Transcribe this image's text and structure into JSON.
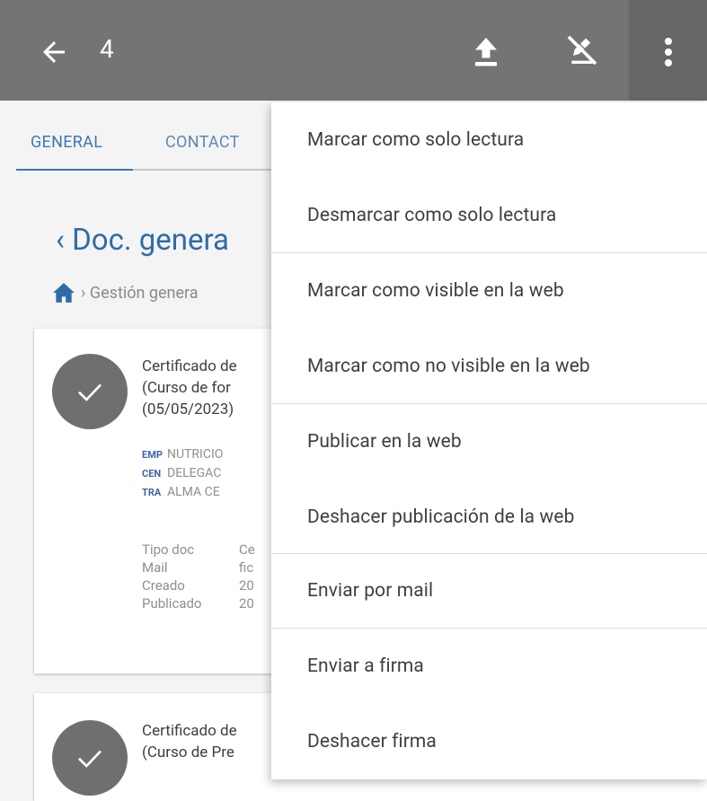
{
  "toolbar": {
    "count": "4",
    "back_icon": "arrow-left-icon",
    "upload_icon": "upload-icon",
    "unsign_icon": "no-sign-icon",
    "more_icon": "more-vertical-icon"
  },
  "tabs": [
    {
      "label": "GENERAL"
    },
    {
      "label": "CONTACT"
    }
  ],
  "page": {
    "title": "‹ Doc. genera",
    "breadcrumb": "› Gestión genera"
  },
  "cards": [
    {
      "title": "Certificado de\n(Curso de for\n(05/05/2023)",
      "tags": [
        {
          "key": "EMP",
          "value": "NUTRICIO"
        },
        {
          "key": "CEN",
          "value": "DELEGAC"
        },
        {
          "key": "TRA",
          "value": "ALMA CE"
        }
      ],
      "meta": [
        {
          "key": "Tipo doc",
          "value": "Ce"
        },
        {
          "key": "Mail",
          "value": "fic"
        },
        {
          "key": "Creado",
          "value": "20"
        },
        {
          "key": "Publicado",
          "value": "20"
        }
      ]
    },
    {
      "title": "Certificado de\n(Curso de Pre"
    }
  ],
  "menu": {
    "items": [
      "Marcar como solo lectura",
      "Desmarcar como solo lectura",
      "Marcar como visible en la web",
      "Marcar como no visible en la web",
      "Publicar en la web",
      "Deshacer publicación de la web",
      "Enviar por mail",
      "Enviar a firma",
      "Deshacer firma"
    ]
  },
  "colors": {
    "toolbar_bg": "#747474",
    "accent": "#3c78b6",
    "check_bg": "#6f6f6f"
  }
}
